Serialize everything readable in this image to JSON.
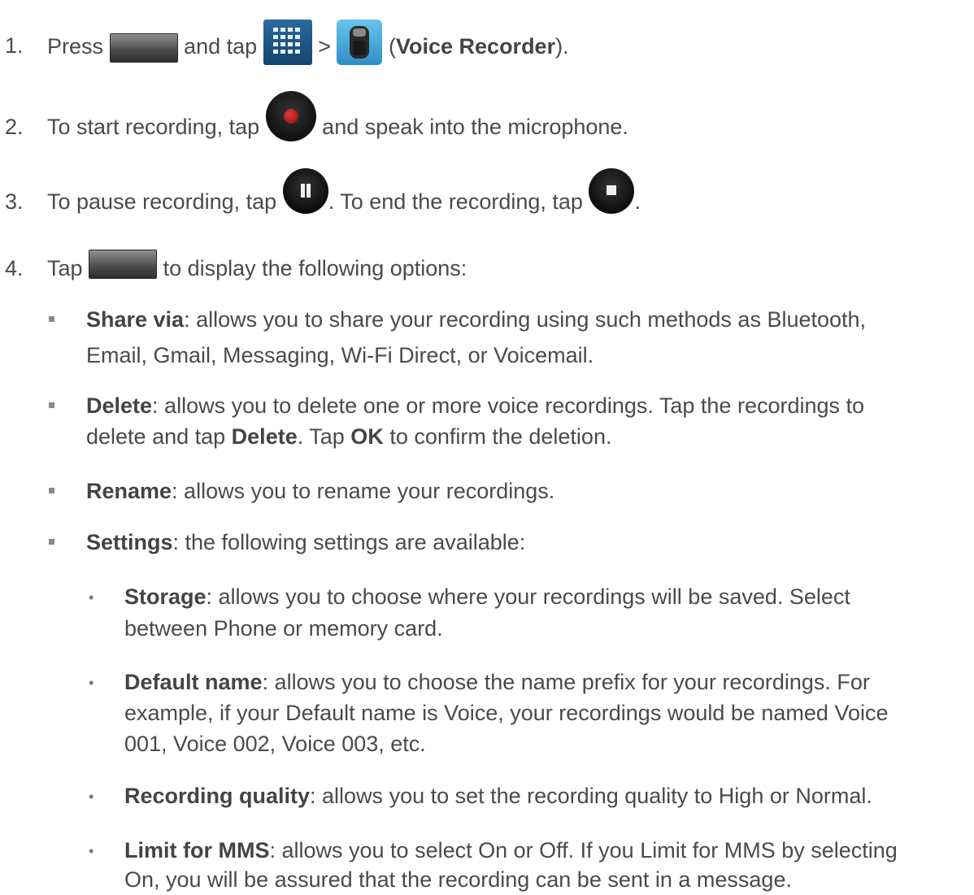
{
  "steps": [
    {
      "num": "1.",
      "a": "Press",
      "b": "and tap",
      "c": ">",
      "d": "(",
      "e": "Voice Recorder",
      "f": ")."
    },
    {
      "num": "2.",
      "a": "To start recording, tap",
      "b": "and speak into the microphone."
    },
    {
      "num": "3.",
      "a": "To pause recording, tap",
      "b": ". To end the recording, tap",
      "c": "."
    },
    {
      "num": "4.",
      "a": "Tap",
      "b": "to display the following options:"
    }
  ],
  "options": {
    "share": {
      "term": "Share via",
      "line1": ": allows you to share your recording using such methods as Bluetooth,",
      "line2": "Email, Gmail, Messaging, Wi-Fi Direct, or Voicemail."
    },
    "delete": {
      "term": "Delete",
      "line1": ": allows you to delete one or more voice recordings. Tap the recordings to",
      "line2a": "delete and tap",
      "line2b": "Delete",
      "line2c": ". Tap",
      "line2d": "OK",
      "line2e": "to confirm the deletion."
    },
    "rename": {
      "term": "Rename",
      "text": ": allows you to rename your recordings."
    },
    "settings": {
      "term": "Settings",
      "text": ": the following settings are available:"
    }
  },
  "settings": {
    "storage": {
      "term": "Storage",
      "line1": ": allows you to choose where your recordings will be saved. Select",
      "line2": "between Phone or memory card."
    },
    "default_name": {
      "term": "Default name",
      "line1": ": allows you to choose the name prefix for your recordings. For",
      "line2": "example, if your Default name is Voice, your recordings would be named Voice",
      "line3": "001, Voice 002, Voice 003, etc."
    },
    "quality": {
      "term": "Recording quality",
      "text": ": allows you to set the recording quality to High or Normal."
    },
    "mms": {
      "term": "Limit for MMS",
      "line1": ": allows you to select On or Off. If you Limit for MMS by selecting",
      "line2": "On, you will be assured that the recording can be sent in a message."
    }
  },
  "bullet_glyph": "•"
}
